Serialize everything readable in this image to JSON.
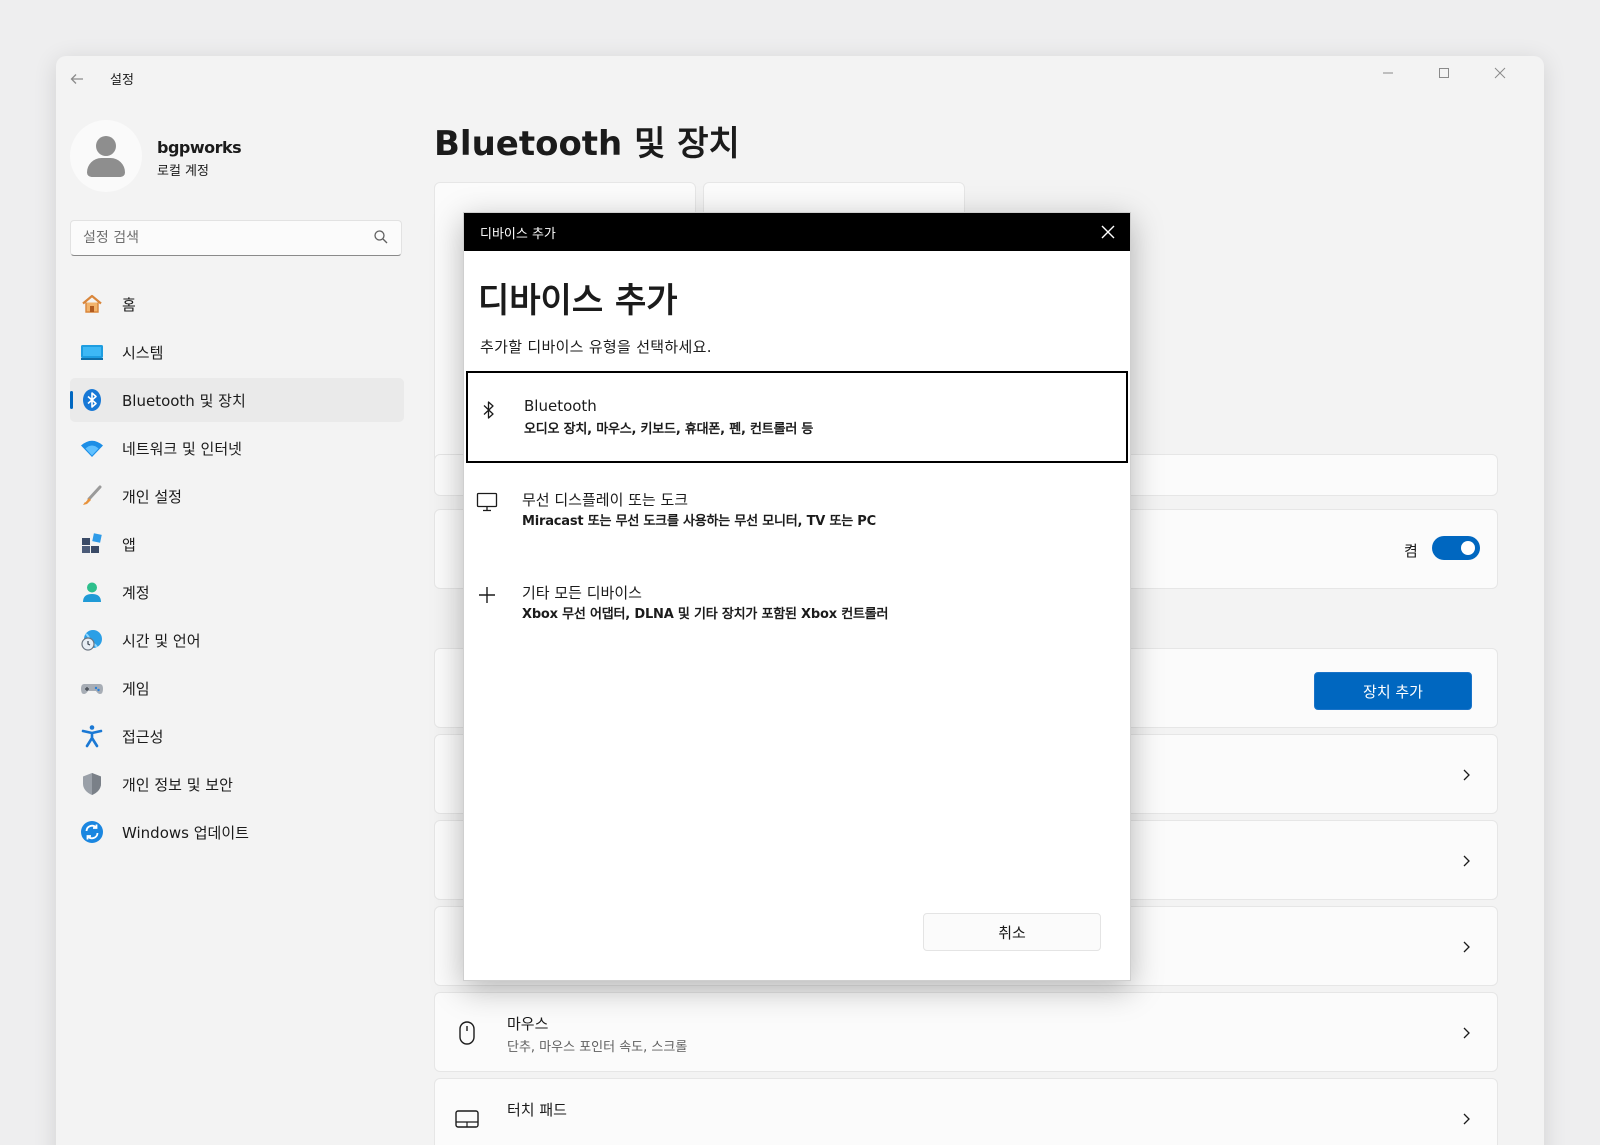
{
  "app": {
    "title": "설정",
    "page_title": "Bluetooth 및 장치"
  },
  "profile": {
    "name": "bgpworks",
    "account_type": "로컬 계정"
  },
  "search": {
    "placeholder": "설정 검색"
  },
  "nav": {
    "items": [
      {
        "label": "홈",
        "icon": "home-icon"
      },
      {
        "label": "시스템",
        "icon": "system-icon"
      },
      {
        "label": "Bluetooth 및 장치",
        "icon": "bluetooth-icon",
        "active": true
      },
      {
        "label": "네트워크 및 인터넷",
        "icon": "wifi-icon"
      },
      {
        "label": "개인 설정",
        "icon": "brush-icon"
      },
      {
        "label": "앱",
        "icon": "apps-icon"
      },
      {
        "label": "계정",
        "icon": "account-icon"
      },
      {
        "label": "시간 및 언어",
        "icon": "clock-globe-icon"
      },
      {
        "label": "게임",
        "icon": "gamepad-icon"
      },
      {
        "label": "접근성",
        "icon": "accessibility-icon"
      },
      {
        "label": "개인 정보 및 보안",
        "icon": "shield-icon"
      },
      {
        "label": "Windows 업데이트",
        "icon": "update-icon"
      }
    ]
  },
  "main": {
    "bluetooth_toggle_label": "켬",
    "bluetooth_toggle_on": true,
    "add_device_button": "장치 추가",
    "cards": [
      {
        "title": "마우스",
        "subtitle": "단추, 마우스 포인터 속도, 스크롤",
        "icon": "mouse-icon"
      },
      {
        "title": "터치 패드",
        "subtitle": "",
        "icon": "touchpad-icon"
      }
    ]
  },
  "dialog": {
    "titlebar": "디바이스 추가",
    "heading": "디바이스 추가",
    "subtitle": "추가할 디바이스 유형을 선택하세요.",
    "options": [
      {
        "title": "Bluetooth",
        "description": "오디오 장치, 마우스, 키보드, 휴대폰, 펜, 컨트롤러 등",
        "icon": "bluetooth-icon",
        "selected": true
      },
      {
        "title": "무선 디스플레이 또는 도크",
        "description": "Miracast 또는 무선 도크를 사용하는 무선 모니터, TV 또는 PC",
        "icon": "monitor-icon"
      },
      {
        "title": "기타 모든 디바이스",
        "description": "Xbox 무선 어댑터, DLNA 및 기타 장치가 포함된 Xbox 컨트롤러",
        "icon": "plus-icon"
      }
    ],
    "cancel_button": "취소"
  },
  "colors": {
    "accent": "#0067c0",
    "window_bg": "#f3f3f3",
    "card_bg": "#fbfbfb",
    "dialog_titlebar": "#000000"
  }
}
